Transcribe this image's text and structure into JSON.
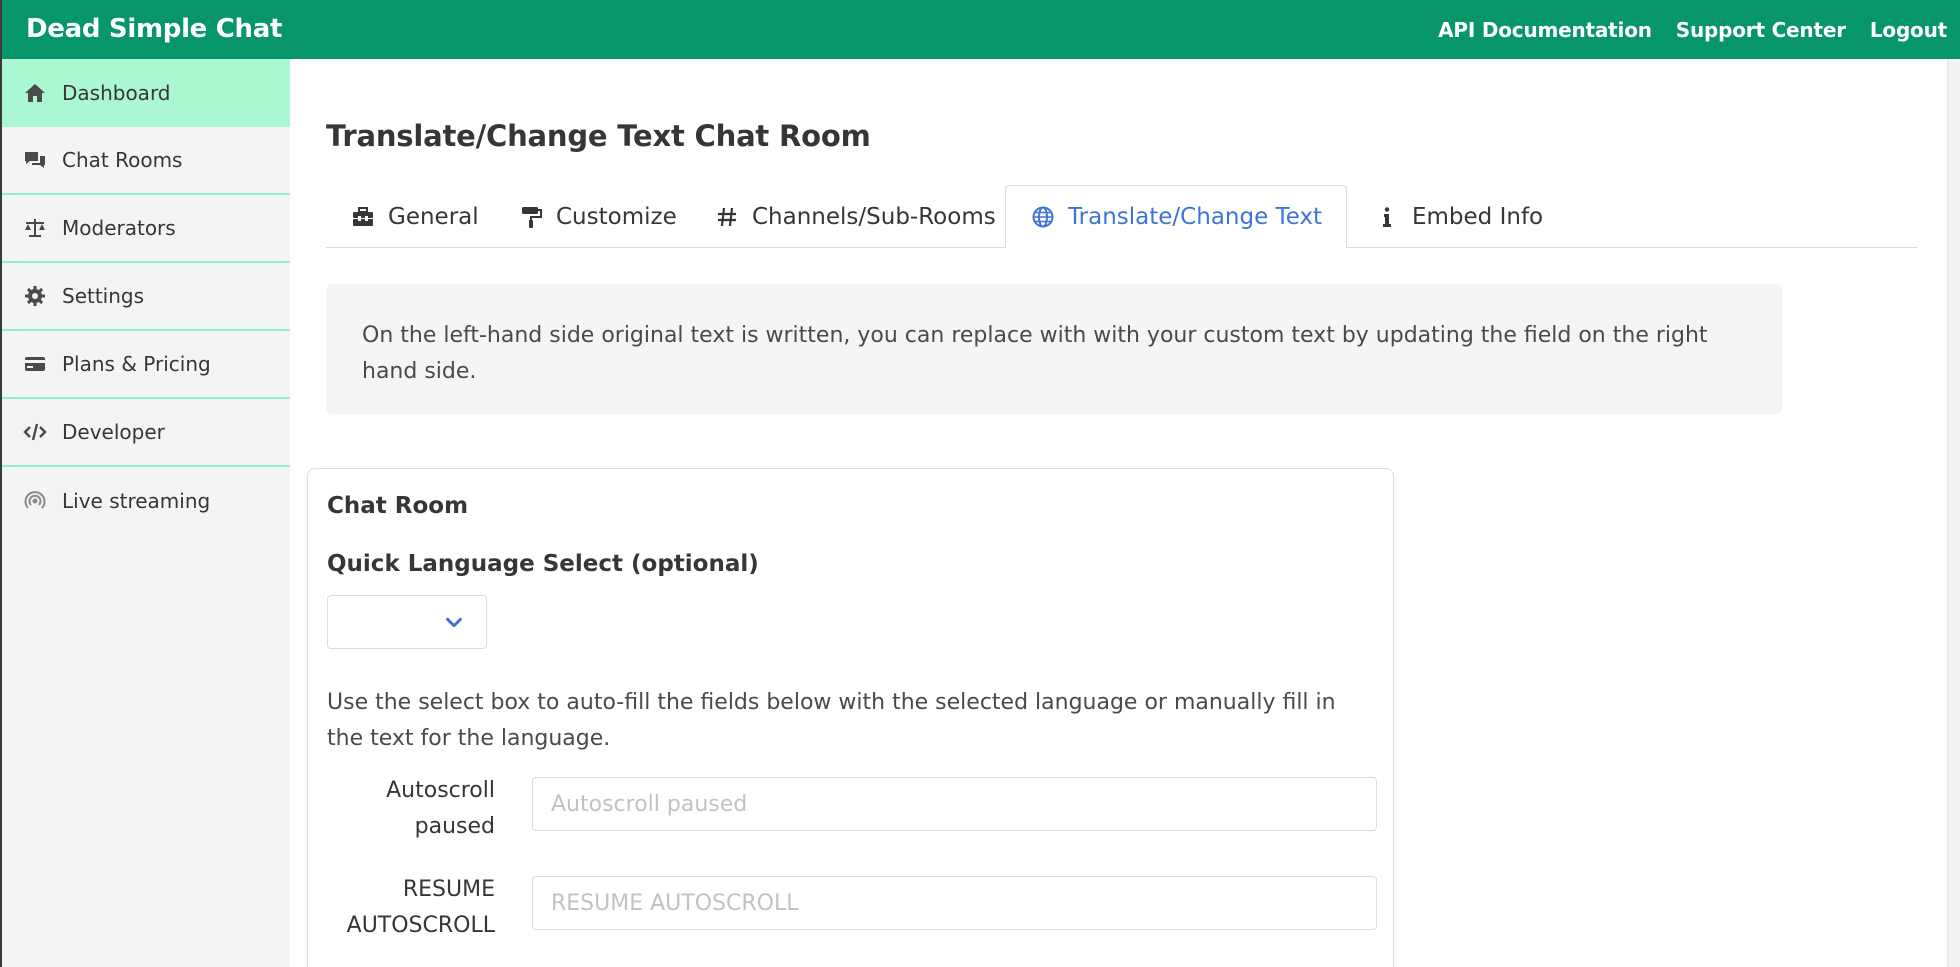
{
  "topbar": {
    "brand": "Dead Simple Chat",
    "links": [
      "API Documentation",
      "Support Center",
      "Logout"
    ]
  },
  "sidebar": {
    "items": [
      {
        "label": "Dashboard",
        "icon": "home-icon",
        "active": true
      },
      {
        "label": "Chat Rooms",
        "icon": "comments-icon"
      },
      {
        "label": "Moderators",
        "icon": "balance-scale-icon"
      },
      {
        "label": "Settings",
        "icon": "gear-icon"
      },
      {
        "label": "Plans & Pricing",
        "icon": "credit-card-icon"
      },
      {
        "label": "Developer",
        "icon": "code-icon"
      },
      {
        "label": "Live streaming",
        "icon": "broadcast-icon"
      }
    ]
  },
  "main": {
    "title": "Translate/Change Text Chat Room",
    "tabs": [
      {
        "label": "General",
        "icon": "toolbox-icon"
      },
      {
        "label": "Customize",
        "icon": "paint-roller-icon"
      },
      {
        "label": "Channels/Sub-Rooms",
        "icon": "hashtag-icon"
      },
      {
        "label": "Translate/Change Text",
        "icon": "globe-icon",
        "active": true
      },
      {
        "label": "Embed Info",
        "icon": "info-icon"
      }
    ],
    "notice": "On the left-hand side original text is written, you can replace with with your custom text by updating the field on the right hand side.",
    "card": {
      "title": "Chat Room",
      "quick_language_label": "Quick Language Select (optional)",
      "quick_language_value": "",
      "help_text": "Use the select box to auto-fill the fields below with the selected language or manually fill in the text for the language.",
      "fields": [
        {
          "label": "Autoscroll paused",
          "placeholder": "Autoscroll paused",
          "value": ""
        },
        {
          "label": "RESUME AUTOSCROLL",
          "placeholder": "RESUME AUTOSCROLL",
          "value": ""
        }
      ]
    }
  },
  "colors": {
    "topbar": "#06966a",
    "sidebar_active": "#abf7d2",
    "sidebar_divider": "#8ff0c8",
    "tab_active": "#3e74d6"
  }
}
